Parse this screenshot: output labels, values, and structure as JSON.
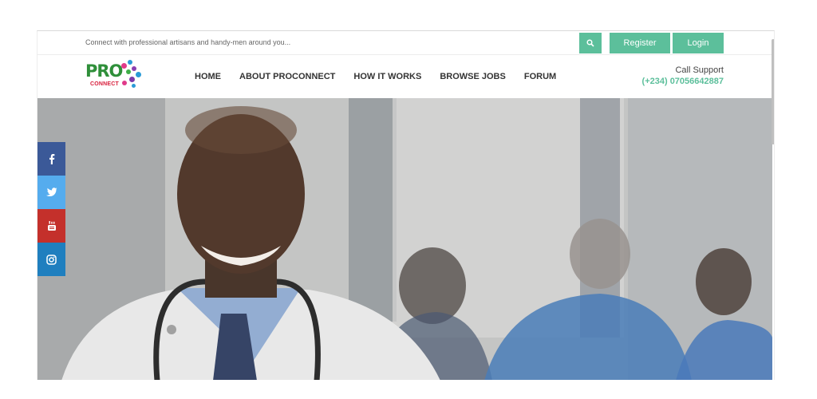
{
  "topbar": {
    "search_placeholder": "Connect with professional artisans and handy-men around you...",
    "search_icon": "search-icon",
    "register_label": "Register",
    "login_label": "Login"
  },
  "logo": {
    "main": "PRO",
    "sub": "CONNECT"
  },
  "nav": {
    "items": [
      {
        "label": "HOME"
      },
      {
        "label": "ABOUT PROCONNECT"
      },
      {
        "label": "HOW IT WORKS"
      },
      {
        "label": "BROWSE JOBS"
      },
      {
        "label": "FORUM"
      }
    ]
  },
  "support": {
    "label": "Call Support",
    "phone": "(+234) 07056642887"
  },
  "social": [
    {
      "name": "facebook",
      "icon": "facebook-icon",
      "color": "#3b5998"
    },
    {
      "name": "twitter",
      "icon": "twitter-icon",
      "color": "#55acee"
    },
    {
      "name": "youtube",
      "icon": "youtube-icon",
      "color": "#c4302b"
    },
    {
      "name": "instagram",
      "icon": "instagram-icon",
      "color": "#1f7fbf"
    }
  ],
  "colors": {
    "accent": "#5cbf9b",
    "nav_text": "#333333"
  }
}
